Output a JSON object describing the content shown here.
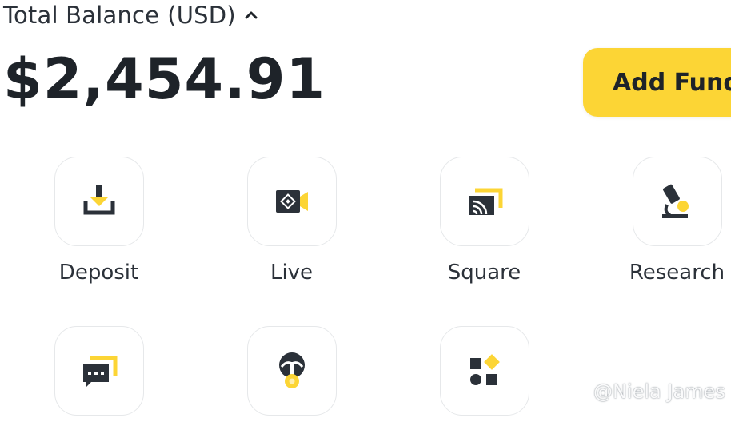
{
  "balance": {
    "label": "Total Balance",
    "currency": "(USD)",
    "amount": "$2,454.91"
  },
  "actions": {
    "add_funds": "Add Funds"
  },
  "colors": {
    "accent": "#FCD535",
    "icon_dark": "#2B3139"
  },
  "tiles": [
    {
      "label": "Deposit",
      "icon": "deposit-icon"
    },
    {
      "label": "Live",
      "icon": "live-icon"
    },
    {
      "label": "Square",
      "icon": "square-icon"
    },
    {
      "label": "Research",
      "icon": "research-icon"
    },
    {
      "label": "",
      "icon": "chat-icon"
    },
    {
      "label": "",
      "icon": "badge-icon"
    },
    {
      "label": "",
      "icon": "more-icon"
    }
  ],
  "watermark": {
    "text": "@Niela James"
  }
}
